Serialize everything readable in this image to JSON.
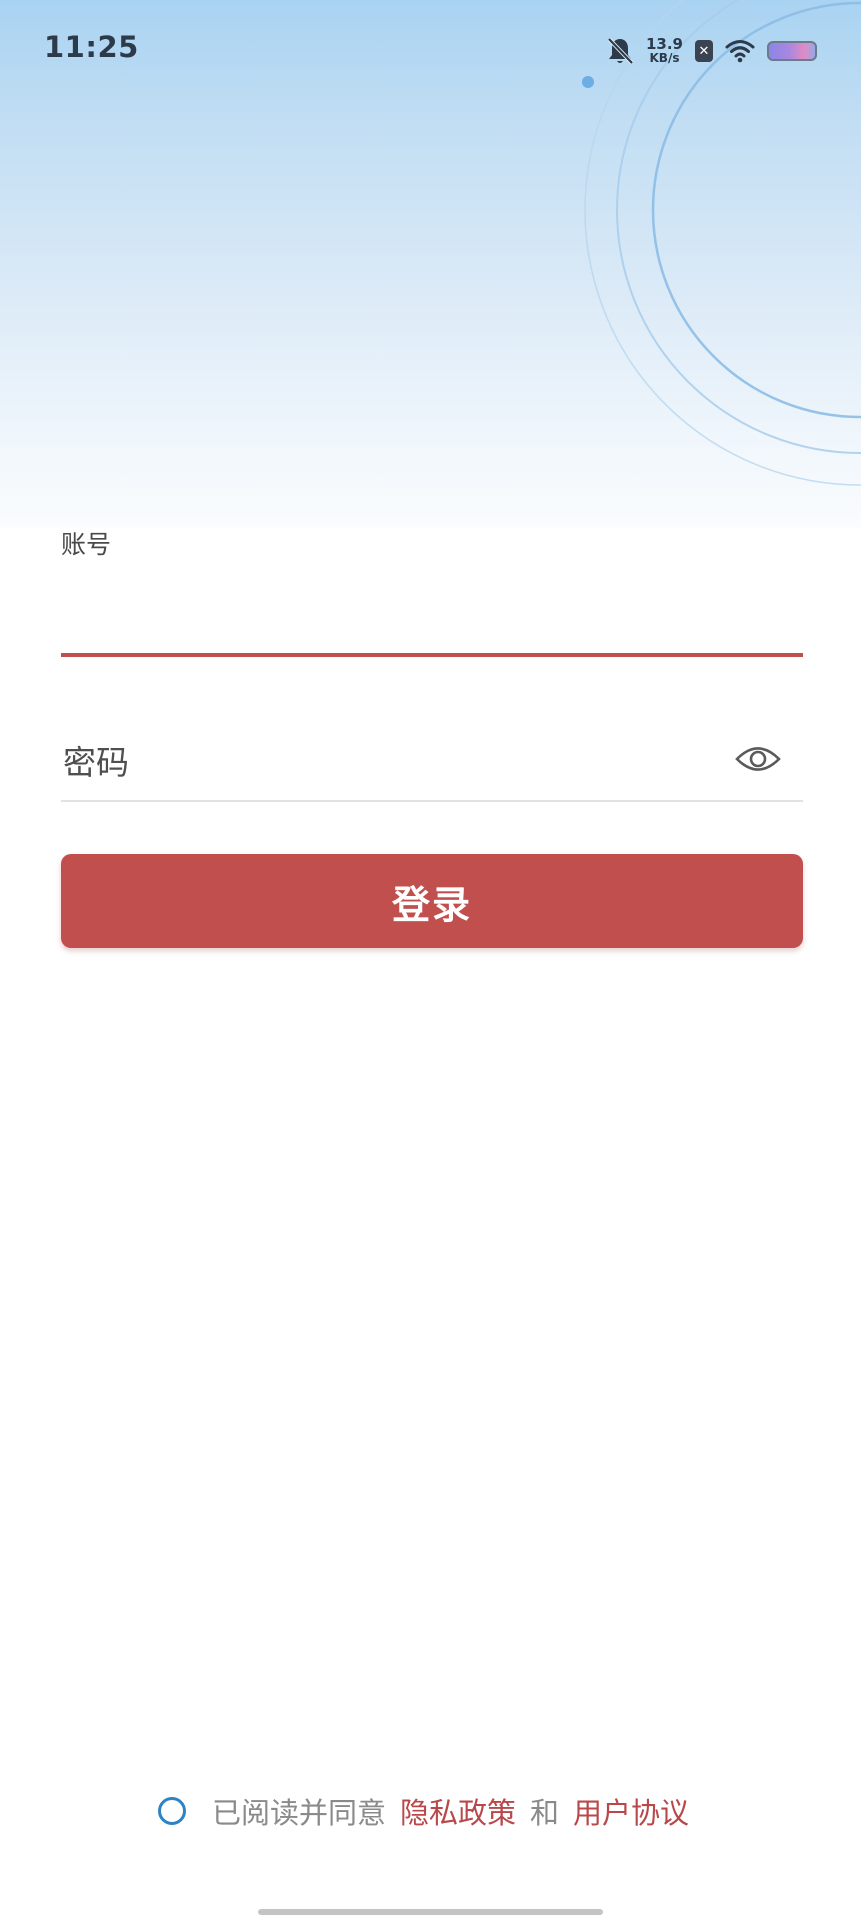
{
  "status_bar": {
    "time": "11:25",
    "net_speed_value": "13.9",
    "net_speed_unit": "KB/s",
    "icons": [
      "bell-off-icon",
      "sim-off-icon",
      "wifi-icon",
      "battery-icon"
    ]
  },
  "login_form": {
    "account_label": "账号",
    "account_value": "",
    "password_placeholder": "密码",
    "password_value": "",
    "login_button_label": "登录"
  },
  "agreement": {
    "checked": false,
    "prefix_text": "已阅读并同意",
    "privacy_link": "隐私政策",
    "and_text": "和",
    "terms_link": "用户协议"
  },
  "colors": {
    "accent": "#c04f4d",
    "link": "#b9484a",
    "radio": "#2e82c6",
    "hero_top": "#a9d3f2"
  }
}
